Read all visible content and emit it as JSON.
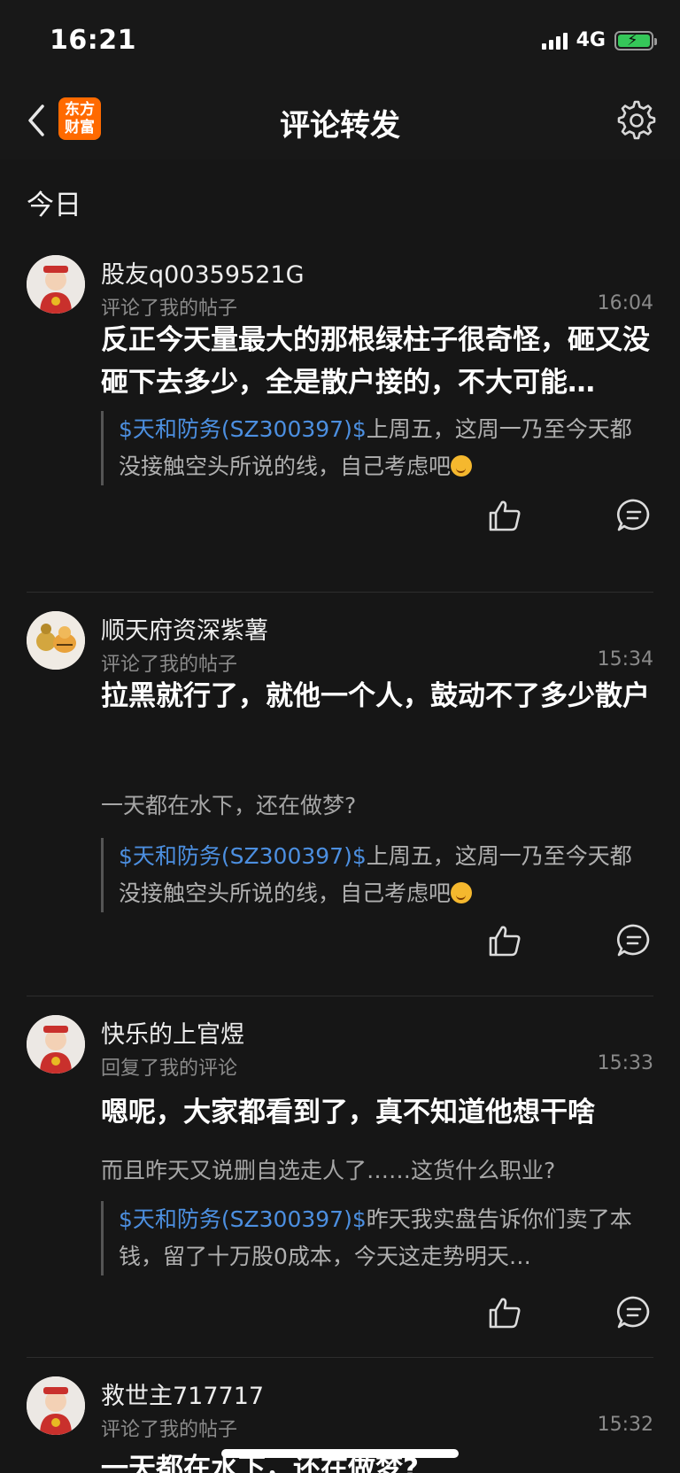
{
  "status_bar": {
    "time": "16:21",
    "network": "4G"
  },
  "nav": {
    "logo_line1": "东方",
    "logo_line2": "财富",
    "title": "评论转发"
  },
  "section": {
    "label": "今日"
  },
  "items": [
    {
      "username": "股友q00359521G",
      "action": "评论了我的帖子",
      "time": "16:04",
      "content": "反正今天量最大的那根绿柱子很奇怪，砸又没砸下去多少，全是散户接的，不大可能…",
      "sub": "",
      "quote_stock": "$天和防务(SZ300397)$",
      "quote_text": "上周五，这周一乃至今天都没接触空头所说的线，自己考虑吧"
    },
    {
      "username": "顺天府资深紫薯",
      "action": "评论了我的帖子",
      "time": "15:34",
      "content": "拉黑就行了，就他一个人，鼓动不了多少散户",
      "sub": "一天都在水下，还在做梦?",
      "quote_stock": "$天和防务(SZ300397)$",
      "quote_text": "上周五，这周一乃至今天都没接触空头所说的线，自己考虑吧"
    },
    {
      "username": "快乐的上官煜",
      "action": "回复了我的评论",
      "time": "15:33",
      "content": "嗯呢，大家都看到了，真不知道他想干啥",
      "sub": "而且昨天又说删自选走人了……这货什么职业?",
      "quote_stock": "$天和防务(SZ300397)$",
      "quote_text": "昨天我实盘告诉你们卖了本钱，留了十万股0成本，今天这走势明天…"
    },
    {
      "username": "救世主717717",
      "action": "评论了我的帖子",
      "time": "15:32",
      "content": "一天都在水下，还在做梦?",
      "sub": "",
      "quote_stock": "",
      "quote_text": ""
    }
  ],
  "colors": {
    "background": "#161616",
    "link": "#4c8fe0",
    "logo": "#ff6a00"
  },
  "icons": [
    "back-icon",
    "settings-icon",
    "like-icon",
    "comment-icon"
  ]
}
